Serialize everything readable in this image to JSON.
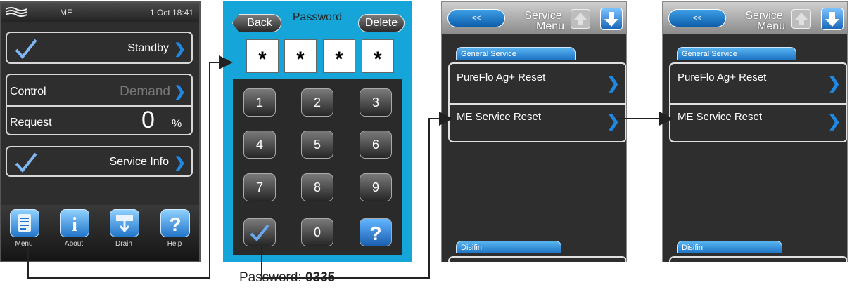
{
  "home": {
    "device": "ME",
    "datetime": "1 Oct 18:41",
    "standby_label": "Standby",
    "control_label": "Control",
    "control_value": "Demand",
    "request_label": "Request",
    "request_value": "0",
    "request_unit": "%",
    "service_info_label": "Service Info",
    "bottom": [
      {
        "label": "Menu",
        "icon": "menu-document-icon"
      },
      {
        "label": "About",
        "icon": "info-icon"
      },
      {
        "label": "Drain",
        "icon": "drain-icon"
      },
      {
        "label": "Help",
        "icon": "help-icon"
      }
    ]
  },
  "password": {
    "back_label": "Back",
    "title": "Password",
    "delete_label": "Delete",
    "masked": [
      "*",
      "*",
      "*",
      "*"
    ],
    "keys": [
      "1",
      "2",
      "3",
      "4",
      "5",
      "6",
      "7",
      "8",
      "9",
      "0"
    ]
  },
  "service_menu": {
    "back_label": "<<",
    "title_line1": "Service",
    "title_line2": "Menu",
    "section_general": "General Service",
    "item_pureflo": "PureFlo Ag+ Reset",
    "item_me_service": "ME Service Reset",
    "section_disinfection": "Disifin"
  },
  "annotation": {
    "label": "Password:",
    "code": "0335"
  },
  "colors": {
    "accent_blue": "#1e88e5",
    "password_bg": "#16a5d9",
    "panel_dark": "#2e2e2e",
    "connector": "#222222"
  }
}
